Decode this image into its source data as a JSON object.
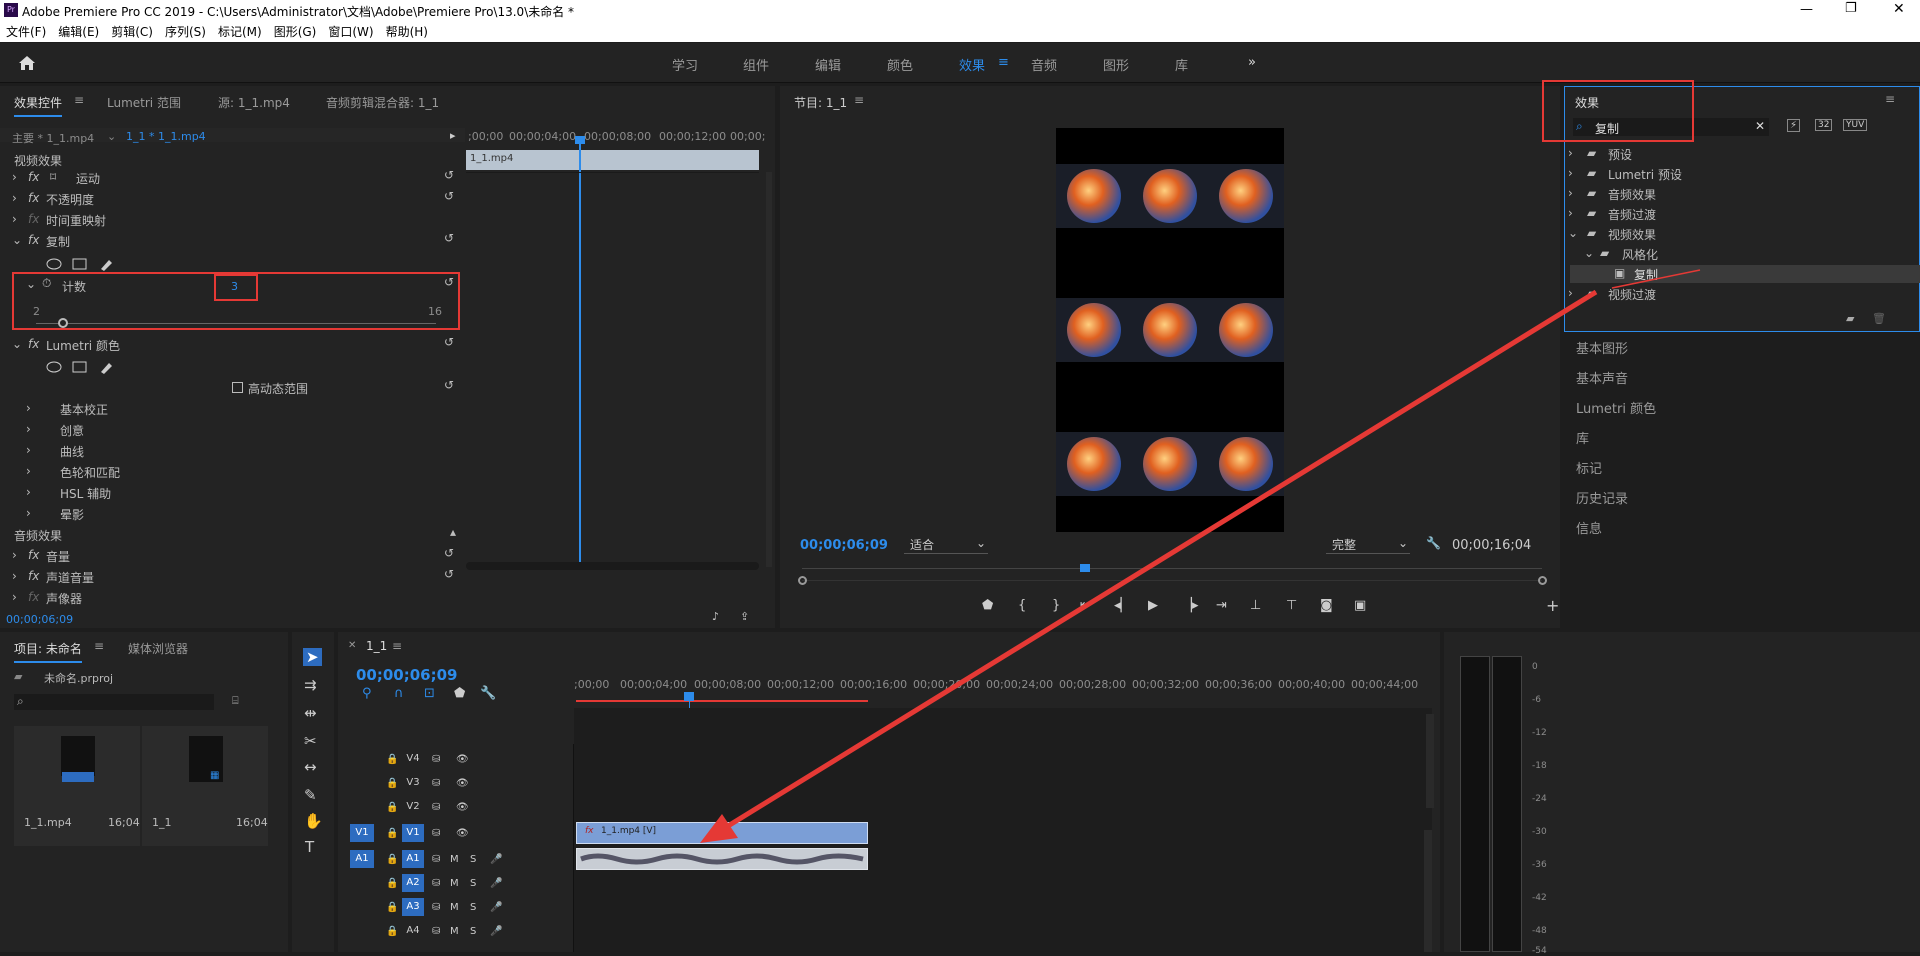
{
  "window": {
    "title": "Adobe Premiere Pro CC 2019 - C:\\Users\\Administrator\\文档\\Adobe\\Premiere Pro\\13.0\\未命名 *"
  },
  "menu": [
    "文件(F)",
    "编辑(E)",
    "剪辑(C)",
    "序列(S)",
    "标记(M)",
    "图形(G)",
    "窗口(W)",
    "帮助(H)"
  ],
  "workspaces": [
    "学习",
    "组件",
    "编辑",
    "颜色",
    "效果",
    "音频",
    "图形",
    "库"
  ],
  "active_workspace": "效果",
  "effect_controls": {
    "tabs": [
      "效果控件",
      "Lumetri 范围",
      "源: 1_1.mp4",
      "音频剪辑混合器: 1_1"
    ],
    "master": "主要 * 1_1.mp4",
    "clip": "1_1 * 1_1.mp4",
    "timecodes": [
      ";00;00",
      "00;00;04;00",
      "00;00;08;00",
      "00;00;12;00",
      "00;00;"
    ],
    "clip_label": "1_1.mp4",
    "video_section": "视频效果",
    "motion": "运动",
    "opacity": "不透明度",
    "time_remap": "时间重映射",
    "replicate": "复制",
    "count_label": "计数",
    "count_value": "3",
    "slider_min": "2",
    "slider_max": "16",
    "count_slider_fraction": 0.07,
    "lumetri": "Lumetri 颜色",
    "hdr": "高动态范围",
    "lumetri_items": [
      "基本校正",
      "创意",
      "曲线",
      "色轮和匹配",
      "HSL 辅助",
      "晕影"
    ],
    "audio_section": "音频效果",
    "volume": "音量",
    "channel_volume": "声道音量",
    "panner": "声像器",
    "bottom_time": "00;00;06;09"
  },
  "program": {
    "title": "节目: 1_1",
    "time": "00;00;06;09",
    "fit": "适合",
    "quality": "完整",
    "duration": "00;00;16;04"
  },
  "effects_panel": {
    "title": "效果",
    "search": "复制",
    "items": [
      {
        "label": "预设"
      },
      {
        "label": "Lumetri 预设"
      },
      {
        "label": "音频效果"
      },
      {
        "label": "音频过渡"
      },
      {
        "label": "视频效果"
      },
      {
        "label": "风格化"
      },
      {
        "label": "复制"
      },
      {
        "label": "视频过渡"
      }
    ],
    "side": [
      "基本图形",
      "基本声音",
      "Lumetri 颜色",
      "库",
      "标记",
      "历史记录",
      "信息"
    ]
  },
  "project": {
    "tabs": [
      "项目: 未命名",
      "媒体浏览器"
    ],
    "file": "未命名.prproj",
    "items": [
      {
        "name": "1_1.mp4",
        "dur": "16;04"
      },
      {
        "name": "1_1",
        "dur": "16;04"
      }
    ]
  },
  "timeline": {
    "tab": "1_1",
    "time": "00;00;06;09",
    "ruler": [
      ";00;00",
      "00;00;04;00",
      "00;00;08;00",
      "00;00;12;00",
      "00;00;16;00",
      "00;00;20;00",
      "00;00;24;00",
      "00;00;28;00",
      "00;00;32;00",
      "00;00;36;00",
      "00;00;40;00",
      "00;00;44;00"
    ],
    "video_tracks": [
      "V4",
      "V3",
      "V2",
      "V1"
    ],
    "audio_tracks": [
      "A1",
      "A2",
      "A3",
      "A4"
    ],
    "src_v": "V1",
    "src_a": "A1",
    "clip_label": "1_1.mp4 [V]",
    "m": "M",
    "s": "S"
  },
  "meter": {
    "scale": [
      "0",
      "-6",
      "-12",
      "-18",
      "-24",
      "-30",
      "-36",
      "-42",
      "-48",
      "-54"
    ]
  }
}
